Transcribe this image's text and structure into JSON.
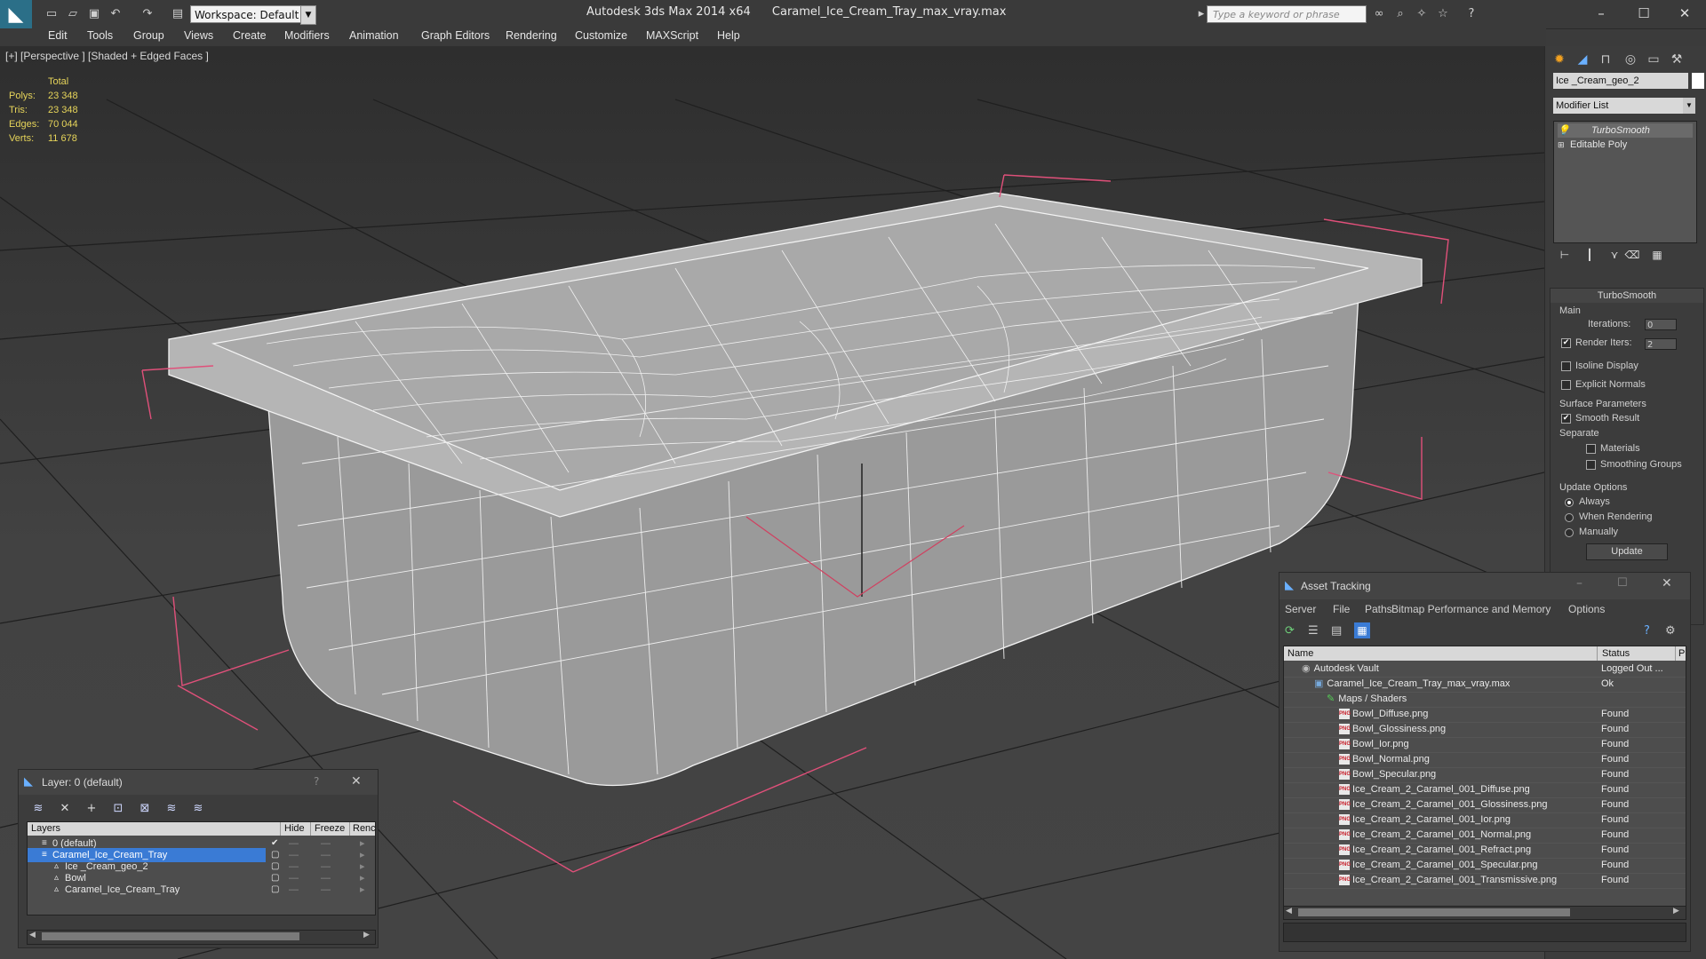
{
  "titlebar": {
    "workspace": "Workspace: Default",
    "app_name": "Autodesk 3ds Max  2014 x64",
    "file_name": "Caramel_Ice_Cream_Tray_max_vray.max",
    "search_placeholder": "Type a keyword or phrase"
  },
  "menu": [
    "Edit",
    "Tools",
    "Group",
    "Views",
    "Create",
    "Modifiers",
    "Animation",
    "Graph Editors",
    "Rendering",
    "Customize",
    "MAXScript",
    "Help"
  ],
  "viewport": {
    "label": "[+] [Perspective ] [Shaded + Edged Faces ]",
    "stats": {
      "header": "Total",
      "rows": [
        {
          "k": "Polys:",
          "v": "23 348"
        },
        {
          "k": "Tris:",
          "v": "23 348"
        },
        {
          "k": "Edges:",
          "v": "70 044"
        },
        {
          "k": "Verts:",
          "v": "11 678"
        }
      ]
    }
  },
  "command_panel": {
    "object_name": "Ice _Cream_geo_2",
    "modifier_list": "Modifier List",
    "stack": [
      "TurboSmooth",
      "Editable Poly"
    ],
    "rollout": {
      "title": "TurboSmooth",
      "main": "Main",
      "iterations_label": "Iterations:",
      "iterations_value": "0",
      "render_iters_label": "Render Iters:",
      "render_iters_value": "2",
      "isoline": "Isoline Display",
      "explicit_normals": "Explicit Normals",
      "surface_params": "Surface Parameters",
      "smooth_result": "Smooth Result",
      "separate": "Separate",
      "materials": "Materials",
      "smoothing_groups": "Smoothing Groups",
      "update_options": "Update Options",
      "always": "Always",
      "when_rendering": "When Rendering",
      "manually": "Manually",
      "update_btn": "Update"
    }
  },
  "asset_tracking": {
    "title": "Asset Tracking",
    "menu": [
      "Server",
      "File",
      "Paths",
      "Bitmap Performance and Memory",
      "Options"
    ],
    "columns": {
      "name": "Name",
      "status": "Status",
      "p": "P"
    },
    "rows": [
      {
        "name": "Autodesk Vault",
        "status": "Logged Out ...",
        "indent": 0,
        "icon": "vault"
      },
      {
        "name": "Caramel_Ice_Cream_Tray_max_vray.max",
        "status": "Ok",
        "indent": 1,
        "icon": "max"
      },
      {
        "name": "Maps / Shaders",
        "status": "",
        "indent": 2,
        "icon": "maps"
      },
      {
        "name": "Bowl_Diffuse.png",
        "status": "Found",
        "indent": 3,
        "icon": "png"
      },
      {
        "name": "Bowl_Glossiness.png",
        "status": "Found",
        "indent": 3,
        "icon": "png"
      },
      {
        "name": "Bowl_Ior.png",
        "status": "Found",
        "indent": 3,
        "icon": "png"
      },
      {
        "name": "Bowl_Normal.png",
        "status": "Found",
        "indent": 3,
        "icon": "png"
      },
      {
        "name": "Bowl_Specular.png",
        "status": "Found",
        "indent": 3,
        "icon": "png"
      },
      {
        "name": "Ice_Cream_2_Caramel_001_Diffuse.png",
        "status": "Found",
        "indent": 3,
        "icon": "png"
      },
      {
        "name": "Ice_Cream_2_Caramel_001_Glossiness.png",
        "status": "Found",
        "indent": 3,
        "icon": "png"
      },
      {
        "name": "Ice_Cream_2_Caramel_001_Ior.png",
        "status": "Found",
        "indent": 3,
        "icon": "png"
      },
      {
        "name": "Ice_Cream_2_Caramel_001_Normal.png",
        "status": "Found",
        "indent": 3,
        "icon": "png"
      },
      {
        "name": "Ice_Cream_2_Caramel_001_Refract.png",
        "status": "Found",
        "indent": 3,
        "icon": "png"
      },
      {
        "name": "Ice_Cream_2_Caramel_001_Specular.png",
        "status": "Found",
        "indent": 3,
        "icon": "png"
      },
      {
        "name": "Ice_Cream_2_Caramel_001_Transmissive.png",
        "status": "Found",
        "indent": 3,
        "icon": "png"
      }
    ],
    "png_badge": "PNG"
  },
  "layer_dialog": {
    "title": "Layer: 0 (default)",
    "help": "?",
    "columns": {
      "layers": "Layers",
      "hide": "Hide",
      "freeze": "Freeze",
      "render": "Renc"
    },
    "rows": [
      {
        "name": "0 (default)",
        "indent": 0,
        "selected": false,
        "current": true
      },
      {
        "name": "Caramel_Ice_Cream_Tray",
        "indent": 0,
        "selected": true,
        "current": false
      },
      {
        "name": "Ice _Cream_geo_2",
        "indent": 1,
        "selected": false,
        "current": false
      },
      {
        "name": "Bowl",
        "indent": 1,
        "selected": false,
        "current": false
      },
      {
        "name": "Caramel_Ice_Cream_Tray",
        "indent": 1,
        "selected": false,
        "current": false
      }
    ]
  },
  "colors": {
    "accent": "#3a7bd5",
    "stats_text": "#e6d45a",
    "selection_box": "#e0507a"
  }
}
